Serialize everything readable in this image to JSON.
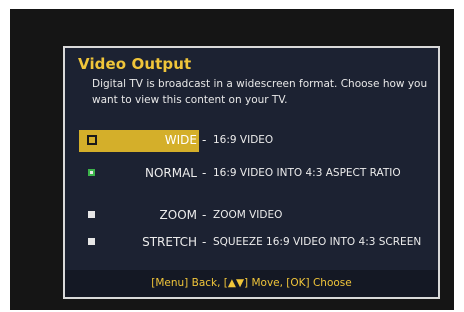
{
  "dialog": {
    "title": "Video Output",
    "description": "Digital TV is broadcast in a widescreen format. Choose how you want to view this content on your TV."
  },
  "options": [
    {
      "name": "WIDE",
      "separator": "-",
      "info": "16:9 VIDEO",
      "focused": true,
      "checked": false
    },
    {
      "name": "NORMAL",
      "separator": "-",
      "info": "16:9 VIDEO INTO 4:3 ASPECT RATIO",
      "focused": false,
      "checked": true
    },
    {
      "name": "ZOOM",
      "separator": "-",
      "info": "ZOOM VIDEO",
      "focused": false,
      "checked": false
    },
    {
      "name": "STRETCH",
      "separator": "-",
      "info": "SQUEEZE 16:9 VIDEO INTO 4:3 SCREEN",
      "focused": false,
      "checked": false
    }
  ],
  "footer": {
    "hint": "[Menu] Back, [▲▼] Move, [OK] Choose"
  },
  "colors": {
    "accent": "#f0c53a",
    "highlight": "#d4af2a",
    "checked": "#3cb44b",
    "dialog_bg": "#1c2232"
  }
}
